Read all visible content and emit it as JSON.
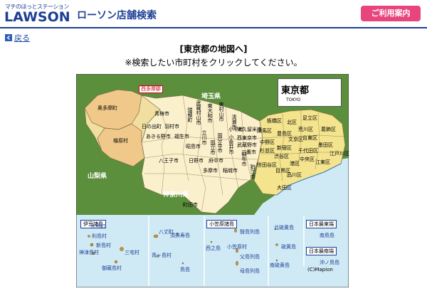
{
  "header": {
    "logo_tagline": "マチのほっとステーション",
    "logo_word": "LAWSON",
    "title": "ローソン店舗検索",
    "guide_button": "ご利用案内"
  },
  "nav": {
    "back_label": "戻る"
  },
  "page": {
    "heading": "[東京都の地図へ]",
    "instruction": "※検索したい市町村をクリックしてください。"
  },
  "map": {
    "region_tag": "西多摩郡",
    "compass_title": "東京都",
    "compass_sub": "TOKYO",
    "prefectures": {
      "saitama": "埼玉県",
      "yamanashi": "山梨県",
      "kanagawa": "神奈川県"
    },
    "west_labels": [
      "奥多摩町",
      "檜原村",
      "青梅市",
      "日の出町",
      "羽村市",
      "あきる野市",
      "福生市",
      "八王子市",
      "昭島市",
      "日野市",
      "町田市",
      "多摩市",
      "稲城市",
      "府中市"
    ],
    "vertical_labels": [
      "瑞穂町",
      "武蔵村山市",
      "東大和市",
      "東村山市",
      "清瀬市",
      "立川市",
      "国立市",
      "国分寺市",
      "小金井市",
      "調布市",
      "狛江市"
    ],
    "central_labels": [
      "東久留米市",
      "西東京市",
      "武蔵野市",
      "三鷹市",
      "小平市",
      "練馬区",
      "板橋区",
      "北区",
      "足立区",
      "葛飾区",
      "荒川区",
      "豊島区",
      "文京区",
      "台東区",
      "墨田区",
      "江戸川区",
      "中野区",
      "杉並区",
      "新宿区",
      "千代田区",
      "江東区",
      "渋谷区",
      "中央区",
      "港区",
      "世田谷区",
      "目黒区",
      "品川区",
      "大田区"
    ],
    "island_boxes": {
      "izu": "伊豆諸島",
      "ogasawara": "小笠原諸島",
      "east": "日本最東端",
      "south": "日本最南端"
    },
    "islands": [
      "大島町",
      "利島村",
      "新島村",
      "神津島村",
      "三宅村",
      "御蔵島村",
      "八丈町",
      "青ヶ島村",
      "須美寿島",
      "鳥島",
      "西之島",
      "聟島列島",
      "父島列島",
      "母島列島",
      "小笠原村",
      "北硫黄島",
      "硫黄島",
      "南硫黄島",
      "南鳥島",
      "沖ノ鳥島"
    ],
    "copyright": "(C)Mapion"
  }
}
